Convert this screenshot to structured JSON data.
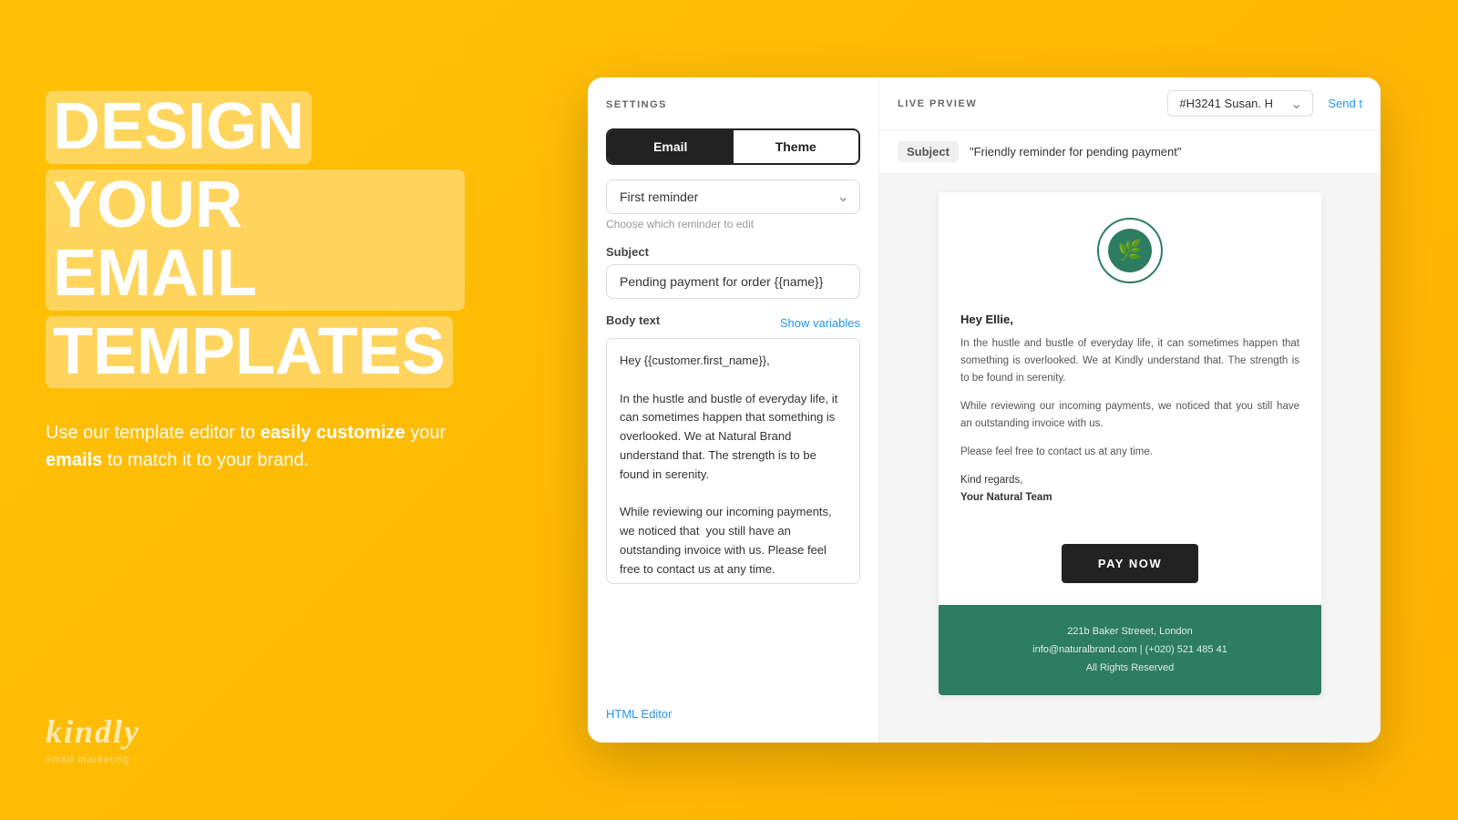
{
  "left": {
    "title_line1": "DESIGN",
    "title_line2": "YOUR EMAIL",
    "title_line3": "TEMPLATES",
    "subtitle_plain1": "Use our template editor to ",
    "subtitle_bold1": "easily customize",
    "subtitle_plain2": " your ",
    "subtitle_bold2": "emails",
    "subtitle_plain3": " to match it to your brand.",
    "brand_name": "kindly",
    "brand_tagline": "email marketing"
  },
  "settings": {
    "panel_title": "SETTINGS",
    "tab_email": "Email",
    "tab_theme": "Theme",
    "dropdown_label": "First reminder",
    "dropdown_hint": "Choose which reminder to edit",
    "subject_label": "Subject",
    "subject_value": "Pending payment for order {{name}}",
    "body_label": "Body text",
    "show_variables_label": "Show variables",
    "body_text": "Hey {{customer.first_name}},\n\nIn the hustle and bustle of everyday life, it can sometimes happen that something is overlooked. We at Natural Brand understand that. The strength is to be found in serenity.\n\nWhile reviewing our incoming payments, we noticed that  you still have an outstanding invoice with us. Please feel free to contact us at any time.\n\nKind regards,\nYour Kindly Team",
    "html_editor_label": "HTML Editor"
  },
  "preview": {
    "panel_title": "LIVE PRVIEW",
    "contact_selector_value": "#H3241 Susan. H",
    "send_label": "Send t",
    "subject_badge": "Subject",
    "subject_value": "\"Friendly reminder for pending payment\"",
    "email": {
      "greeting": "Hey Ellie,",
      "paragraph1": "In the hustle and bustle of everyday life, it can sometimes happen that something is overlooked. We at Kindly understand that. The strength is to be found in serenity.",
      "paragraph2": "While reviewing our incoming payments, we noticed that you still have an outstanding invoice with us.",
      "paragraph3": "Please feel free to contact us at any time.",
      "signature_line1": "Kind regards,",
      "signature_line2": "Your Natural Team",
      "pay_button": "PAY NOW",
      "footer_address": "221b Baker Streeet, London",
      "footer_email_phone": "info@naturalbrand.com | (+020) 521 485 41",
      "footer_rights": "All Rights Reserved"
    }
  },
  "colors": {
    "yellow": "#FFC107",
    "dark": "#222222",
    "teal": "#2d7d62",
    "blue_link": "#2196F3"
  }
}
